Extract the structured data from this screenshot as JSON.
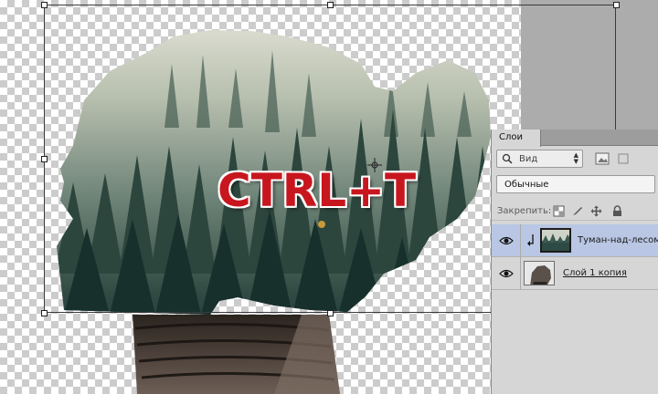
{
  "overlay": {
    "shortcut_text": "CTRL+T"
  },
  "layers_panel": {
    "tab_label": "Слои",
    "filter": {
      "label": "Вид"
    },
    "blend_mode": {
      "label": "Обычные"
    },
    "lock": {
      "label": "Закрепить:"
    },
    "layers": [
      {
        "name": "Туман-над-лесом",
        "selected": true,
        "visible": true,
        "clipped": true
      },
      {
        "name": "Слой 1 копия",
        "selected": false,
        "visible": true,
        "clipped": false
      }
    ]
  },
  "colors": {
    "selected_layer": "#b9c7e4",
    "overlay_text": "#c8161e",
    "panel_bg": "#d6d6d6"
  },
  "icons": [
    "search-icon",
    "image-filter-icon",
    "lock-pixels-icon",
    "lock-brush-icon",
    "lock-position-icon",
    "lock-all-icon",
    "eye-icon",
    "clip-arrow-icon"
  ]
}
